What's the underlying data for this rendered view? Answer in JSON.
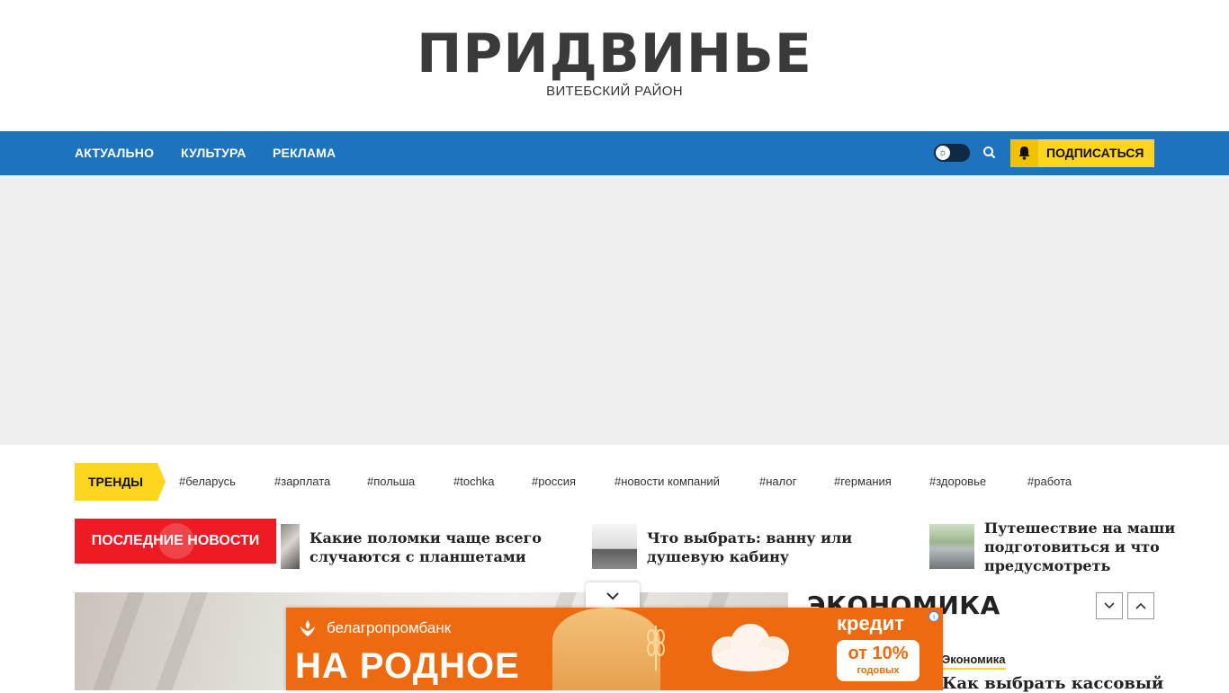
{
  "header": {
    "logo": "ПРИДВИНЬЕ",
    "tagline": "ВИТЕБСКИЙ РАЙОН"
  },
  "nav": {
    "items": [
      {
        "label": "АКТУАЛЬНО"
      },
      {
        "label": "КУЛЬТУРА"
      },
      {
        "label": "РЕКЛАМА"
      }
    ],
    "dark_mode_icon": "sun-icon",
    "search_icon": "search-icon",
    "subscribe_label": "ПОДПИСАТЬСЯ",
    "subscribe_icon": "bell-icon"
  },
  "trends": {
    "label": "ТРЕНДЫ",
    "tags": [
      "#беларусь",
      "#зарплата",
      "#польша",
      "#tochka",
      "#россия",
      "#новости компаний",
      "#налог",
      "#германия",
      "#здоровье",
      "#работа"
    ]
  },
  "latest": {
    "label": "ПОСЛЕДНИЕ НОВОСТИ",
    "items": [
      {
        "title_line1": "Какие поломки чаще всего",
        "title_line2": "случаются с планшетами"
      },
      {
        "title_line1": "Что выбрать: ванну или",
        "title_line2": "душевую кабину"
      },
      {
        "title_line1": "Путешествие на маши",
        "title_line2": "подготовиться и что",
        "title_line3": "предусмотреть"
      }
    ]
  },
  "section": {
    "title": "ЭКОНОМИКА",
    "category": "Экономика",
    "article_title": "Как выбрать кассовый"
  },
  "banner": {
    "brand": "белагропромбанк",
    "headline": "НА РОДНОЕ",
    "credit": "кредит",
    "rate_main": "от 10%",
    "rate_sub": "годовых",
    "info": "i"
  },
  "colors": {
    "nav": "#1e73be",
    "accent_yellow": "#ffd51e",
    "latest_red": "#ed1c24",
    "banner_orange": "#ee6a10"
  }
}
